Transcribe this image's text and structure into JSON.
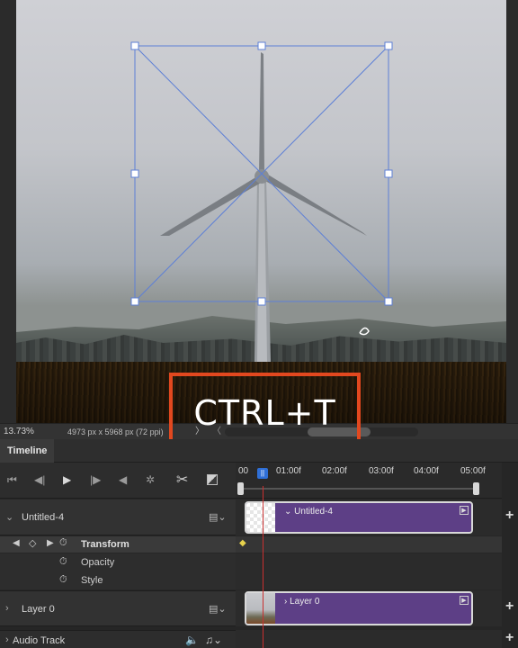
{
  "canvas": {
    "zoom": "13.73%",
    "doc_size": "4973 px x 5968 px (72 ppi)",
    "status_arrow": "〉",
    "scroll_left": "〈"
  },
  "overlay": {
    "shortcut": "CTRL+T",
    "highlight_color": "#e2481f"
  },
  "timeline": {
    "tab": "Timeline",
    "ruler": [
      "00",
      "01:00f",
      "02:00f",
      "03:00f",
      "04:00f",
      "05:00f"
    ],
    "playhead_label": "||",
    "controls": [
      "first-frame-icon",
      "prev-frame-icon",
      "play-icon",
      "next-frame-icon",
      "audio-icon",
      "settings-icon",
      "split-icon",
      "transition-icon"
    ],
    "groups": {
      "untitled": {
        "label": "Untitled-4",
        "clip_label": "Untitled-4"
      },
      "layer0": {
        "label": "Layer 0",
        "clip_label": "Layer 0"
      },
      "audio": {
        "label": "Audio Track"
      }
    },
    "properties": {
      "transform": "Transform",
      "opacity": "Opacity",
      "style": "Style"
    },
    "clip_color": "#5d3f86",
    "playhead_color": "#c93030"
  }
}
